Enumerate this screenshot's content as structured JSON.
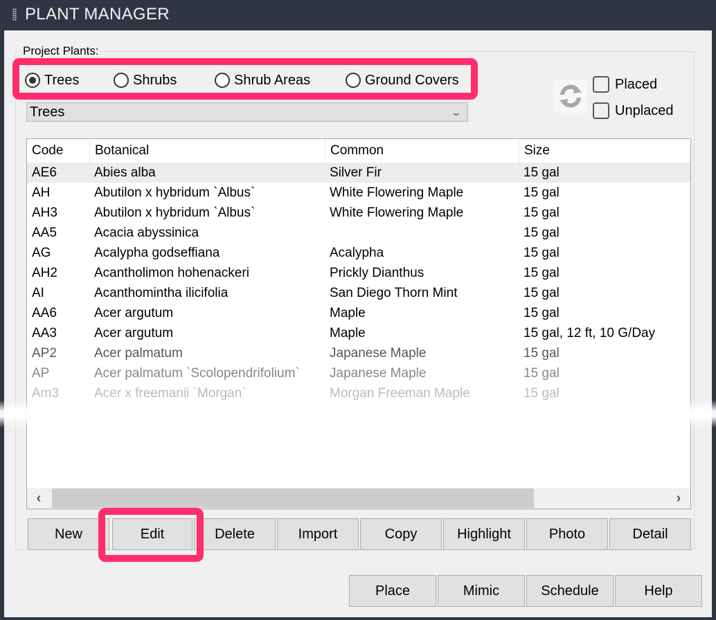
{
  "window": {
    "title": "PLANT MANAGER"
  },
  "project_plants": {
    "label": "Project Plants:",
    "radios": [
      {
        "label": "Trees",
        "selected": true
      },
      {
        "label": "Shrubs",
        "selected": false
      },
      {
        "label": "Shrub Areas",
        "selected": false
      },
      {
        "label": "Ground Covers",
        "selected": false
      }
    ],
    "dropdown_value": "Trees",
    "refresh_icon": "refresh-icon",
    "checkboxes": [
      {
        "label": "Placed",
        "checked": false
      },
      {
        "label": "Unplaced",
        "checked": false
      }
    ]
  },
  "table": {
    "columns": [
      "Code",
      "Botanical",
      "Common",
      "Size"
    ],
    "rows": [
      {
        "code": "AE6",
        "botanical": "Abies alba",
        "common": "Silver Fir",
        "size": "15 gal"
      },
      {
        "code": "AH",
        "botanical": "Abutilon x hybridum `Albus`",
        "common": "White Flowering Maple",
        "size": "15 gal"
      },
      {
        "code": "AH3",
        "botanical": "Abutilon x hybridum `Albus`",
        "common": "White Flowering Maple",
        "size": "15 gal"
      },
      {
        "code": "AA5",
        "botanical": "Acacia abyssinica",
        "common": "",
        "size": "15 gal"
      },
      {
        "code": "AG",
        "botanical": "Acalypha godseffiana",
        "common": "Acalypha",
        "size": "15 gal"
      },
      {
        "code": "AH2",
        "botanical": "Acantholimon hohenackeri",
        "common": "Prickly Dianthus",
        "size": "15 gal"
      },
      {
        "code": "AI",
        "botanical": "Acanthomintha ilicifolia",
        "common": "San Diego Thorn Mint",
        "size": "15 gal"
      },
      {
        "code": "AA6",
        "botanical": "Acer argutum",
        "common": "Maple",
        "size": "15 gal"
      },
      {
        "code": "AA3",
        "botanical": "Acer argutum",
        "common": "Maple",
        "size": "15 gal, 12 ft, 10 G/Day"
      },
      {
        "code": "AP2",
        "botanical": "Acer palmatum",
        "common": "Japanese Maple",
        "size": "15 gal"
      },
      {
        "code": "AP",
        "botanical": "Acer palmatum  `Scolopendrifolium`",
        "common": "Japanese Maple",
        "size": "15 gal"
      },
      {
        "code": "Am3",
        "botanical": "Acer x freemanii `Morgan`",
        "common": "Morgan Freeman Maple",
        "size": "15 gal"
      },
      {
        "code": "AC",
        "botanical": "Alnus cordata",
        "common": "Italian Alder",
        "size": "15 gal"
      }
    ]
  },
  "actions": [
    "New",
    "Edit",
    "Delete",
    "Import",
    "Copy",
    "Highlight",
    "Photo",
    "Detail"
  ],
  "footer_actions": [
    "Place",
    "Mimic",
    "Schedule",
    "Help"
  ],
  "colors": {
    "highlight": "#ff2d6c",
    "titlebar": "#2f3542"
  }
}
